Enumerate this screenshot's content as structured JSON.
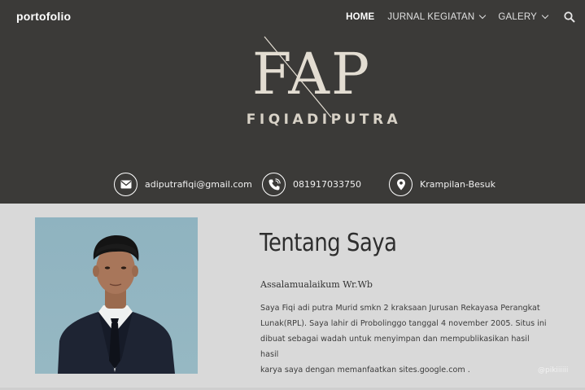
{
  "header": {
    "site_title": "portofolio",
    "nav": [
      {
        "label": "HOME",
        "active": true,
        "dropdown": false
      },
      {
        "label": "JURNAL KEGIATAN",
        "active": false,
        "dropdown": true
      },
      {
        "label": "GALERY",
        "active": false,
        "dropdown": true
      }
    ],
    "search_icon": "search-icon"
  },
  "hero": {
    "logo_mark": "FAP",
    "logo_name": "FIQIADIPUTRA",
    "contacts": [
      {
        "icon": "email-icon",
        "text": "adiputrafiqi@gmail.com"
      },
      {
        "icon": "phone-icon",
        "text": "081917033750"
      },
      {
        "icon": "location-icon",
        "text": "Krampilan-Besuk"
      }
    ]
  },
  "about": {
    "title": "Tentang Saya",
    "greeting": "Assalamualaikum Wr.Wb",
    "lines": [
      "Saya Fiqi adi putra Murid smkn 2 kraksaan Jurusan Rekayasa Perangkat",
      "Lunak(RPL). Saya lahir di Probolinggo tanggal 4 november 2005. Situs ini",
      "dibuat sebagai wadah untuk menyimpan dan mempublikasikan hasil hasil",
      "karya saya dengan memanfaatkan sites.google.com  ."
    ]
  },
  "watermark": "@pikiiiiii",
  "colors": {
    "hero_bg": "#3b3a38",
    "section_bg": "#d9d9d9",
    "logo": "#e3ddd2"
  }
}
